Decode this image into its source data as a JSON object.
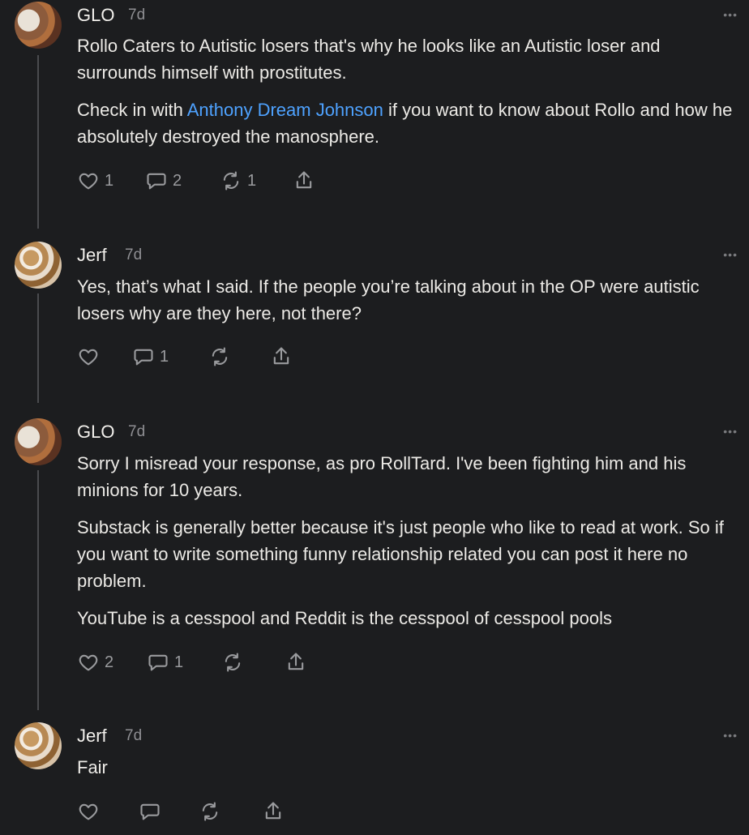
{
  "comments": [
    {
      "author": "GLO",
      "time": "7d",
      "paragraphs": [
        "Rollo Caters to Autistic losers that's why he looks like an Autistic loser and surrounds himself with prostitutes."
      ],
      "para2_prefix": "Check in with ",
      "para2_link": "Anthony Dream Johnson",
      "para2_suffix": " if you want to know about Rollo and how he absolutely destroyed the manosphere.",
      "likes": "1",
      "replies": "2",
      "restacks": "1"
    },
    {
      "author": "Jerf",
      "time": "7d",
      "paragraphs": [
        "Yes, that’s what I said. If the people you’re talking about in the OP were autistic losers why are they here, not there?"
      ],
      "likes": "",
      "replies": "1",
      "restacks": ""
    },
    {
      "author": "GLO",
      "time": "7d",
      "paragraphs": [
        "Sorry I misread your response, as pro RollTard. I've been fighting him and his minions for 10 years.",
        "Substack is generally better because it's just people who like to read at work. So if you want to write something funny relationship related you can post it here no problem.",
        "YouTube is a cesspool and Reddit is the cesspool of cesspool pools"
      ],
      "likes": "2",
      "replies": "1",
      "restacks": ""
    },
    {
      "author": "Jerf",
      "time": "7d",
      "paragraphs": [
        "Fair"
      ],
      "likes": "",
      "replies": "",
      "restacks": ""
    }
  ],
  "icons": {
    "more": "more-options-icon",
    "like": "heart-icon",
    "reply": "comment-bubble-icon",
    "restack": "restack-arrows-icon",
    "share": "share-upload-icon"
  },
  "colors": {
    "background": "#1c1d1f",
    "link": "#4ea2ff",
    "text": "#eceae6",
    "muted": "#9a9b9e"
  },
  "more_label": "•••"
}
